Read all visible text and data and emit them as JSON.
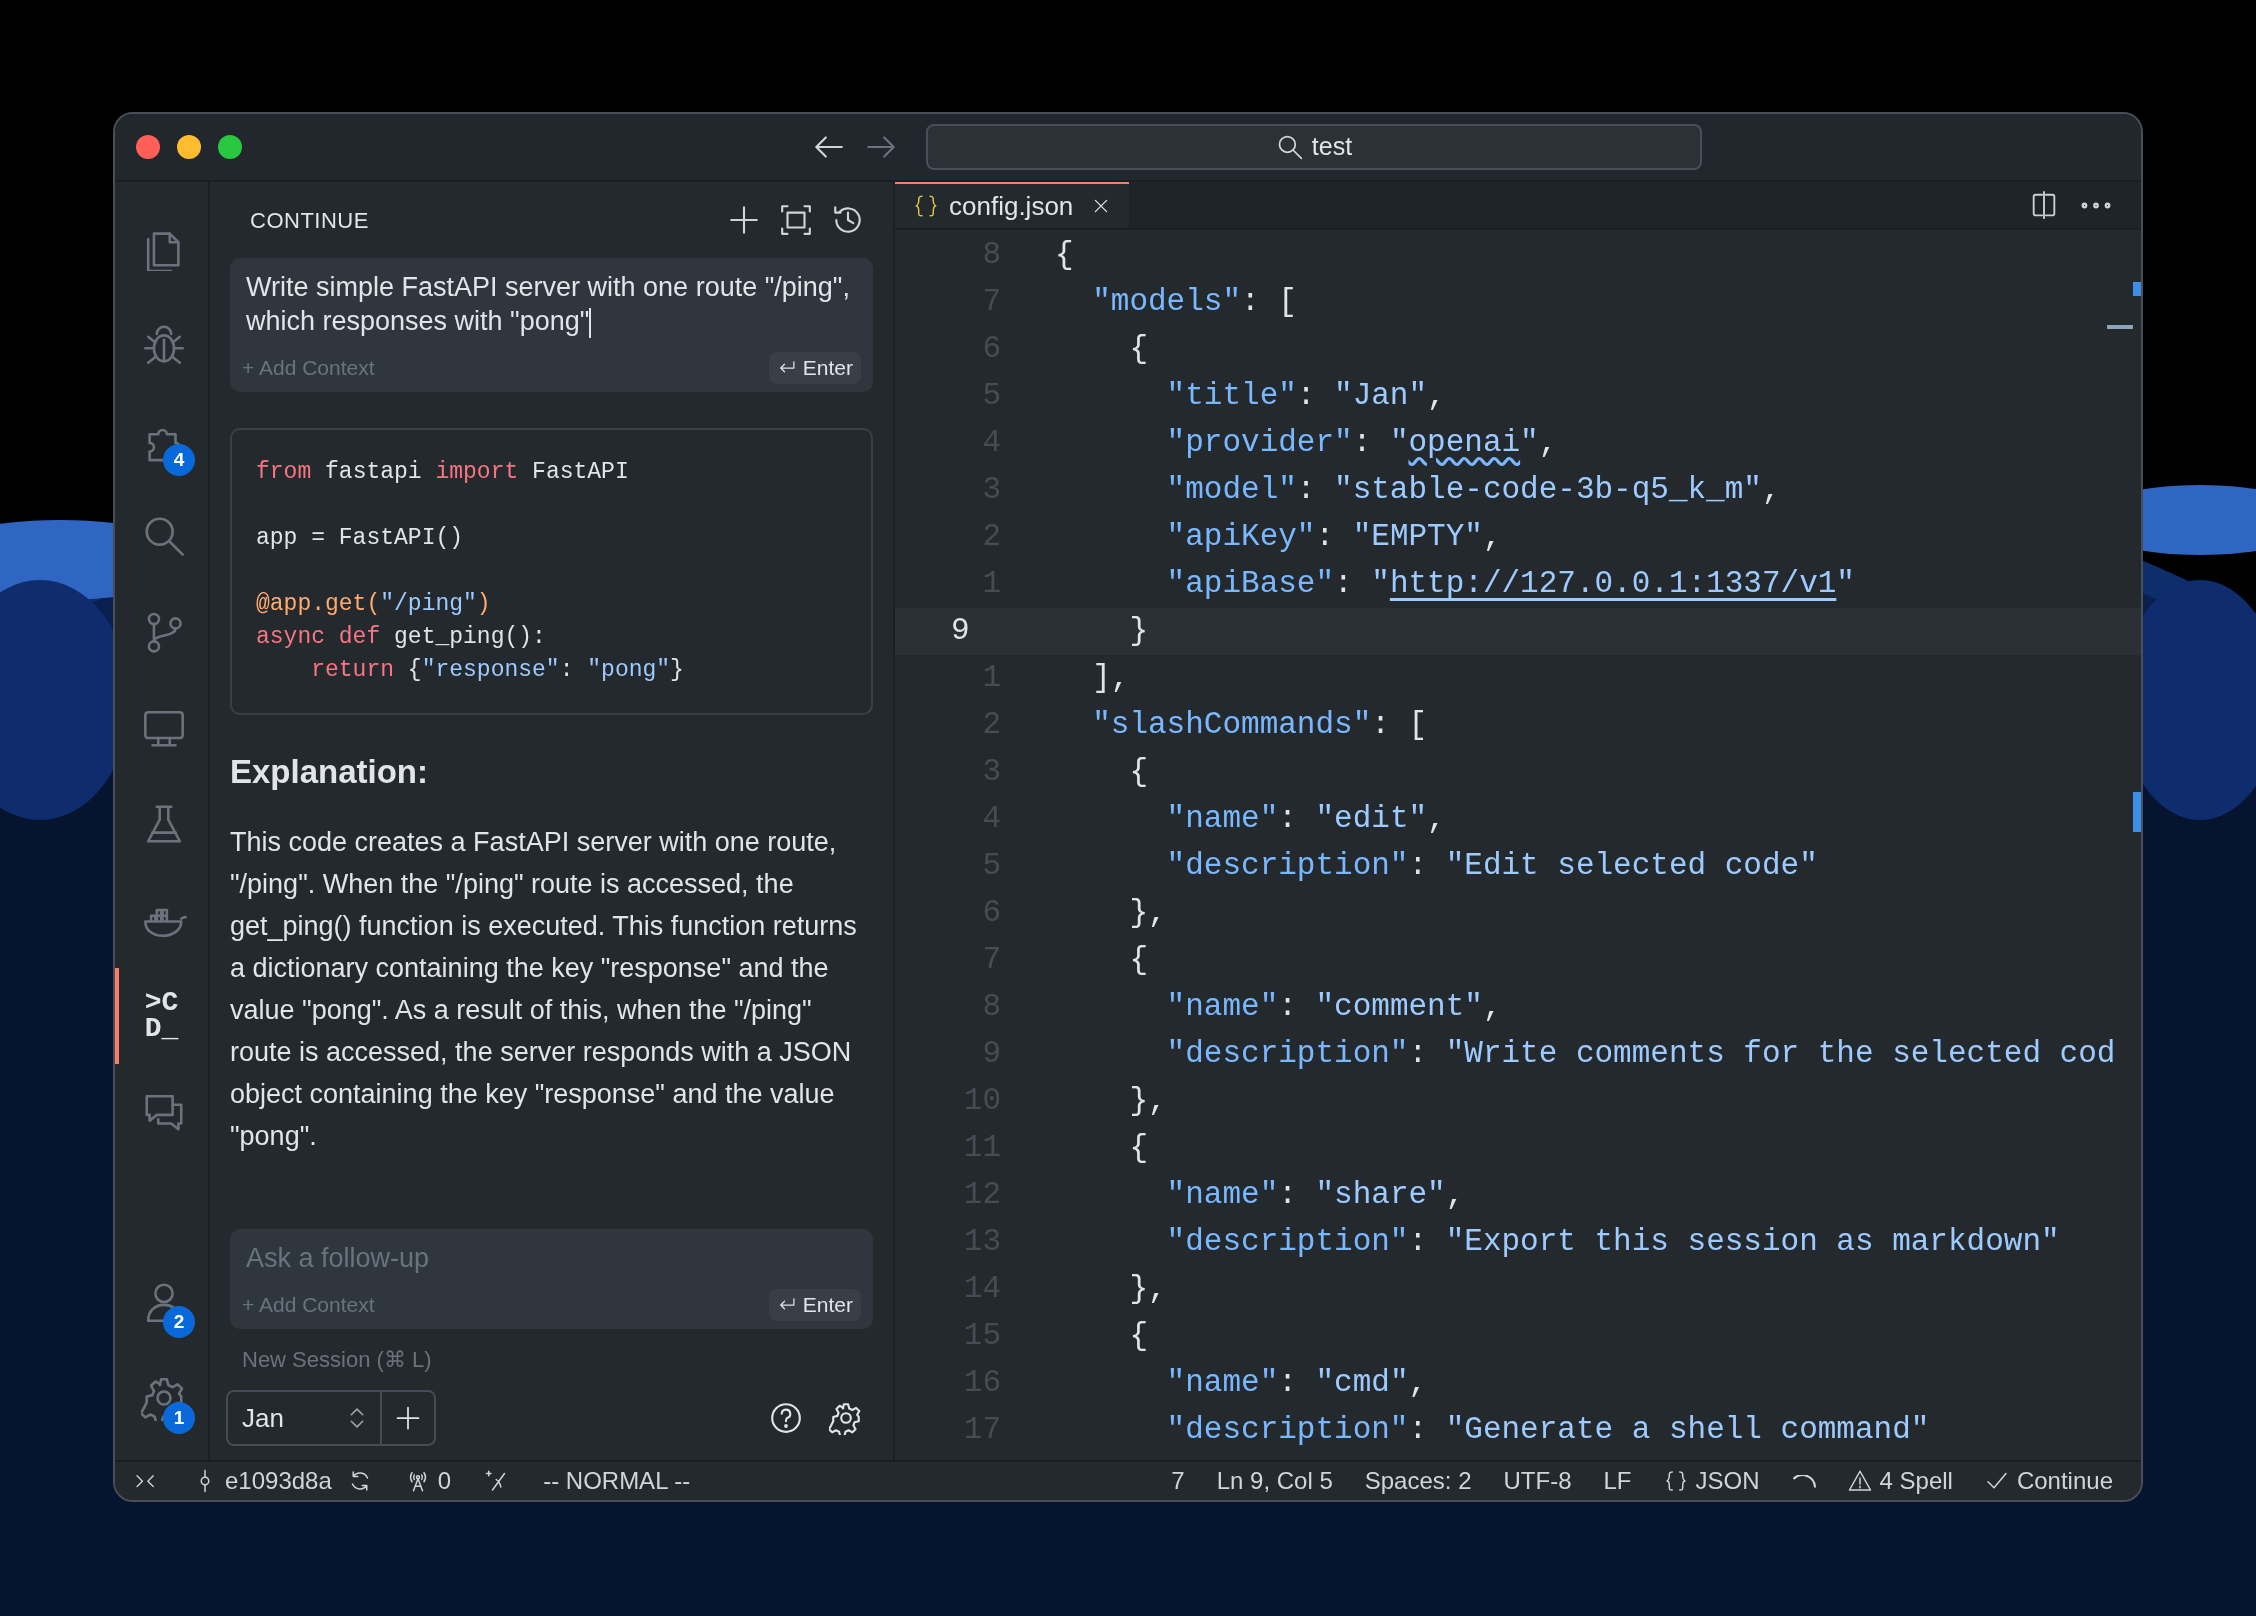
{
  "window": {
    "nav": [
      {
        "kind": "back",
        "disabled": false
      },
      {
        "kind": "forward",
        "disabled": true
      }
    ],
    "search": {
      "value": "test"
    }
  },
  "activity_bar": {
    "top": [
      {
        "kind": "files",
        "selected": false
      },
      {
        "kind": "debug",
        "selected": false
      },
      {
        "kind": "extensions",
        "selected": false,
        "badge": "4"
      },
      {
        "kind": "search",
        "selected": false
      },
      {
        "kind": "source-control",
        "selected": false
      },
      {
        "kind": "remote",
        "selected": false
      },
      {
        "kind": "testing",
        "selected": false
      },
      {
        "kind": "docker",
        "selected": false
      },
      {
        "kind": "continue",
        "selected": true,
        "lines": [
          ">C",
          "D_"
        ]
      },
      {
        "kind": "chat",
        "selected": false
      }
    ],
    "bottom": [
      {
        "kind": "accounts",
        "selected": false,
        "badge": "2"
      },
      {
        "kind": "settings",
        "selected": false,
        "badge": "1"
      }
    ]
  },
  "side_panel": {
    "title": "CONTINUE",
    "actions": [
      {
        "kind": "add"
      },
      {
        "kind": "fullscreen"
      },
      {
        "kind": "history"
      }
    ],
    "prompt": {
      "text": "Write simple FastAPI server with one route \"/ping\", which responses with \"pong\"",
      "add_context": "+ Add Context",
      "enter": "Enter"
    },
    "code_block": [
      {
        "lines": [
          [
            {
              "kind": "kw",
              "text": "from"
            },
            {
              "kind": "plain",
              "text": " fastapi "
            },
            {
              "kind": "kw",
              "text": "import"
            },
            {
              "kind": "plain",
              "text": " FastAPI"
            }
          ]
        ]
      },
      {
        "lines": [
          [
            {
              "kind": "plain",
              "text": "app = FastAPI()"
            }
          ]
        ]
      },
      {
        "lines": [
          [
            {
              "kind": "dec",
              "text": "@app.get("
            },
            {
              "kind": "str",
              "text": "\"/ping\""
            },
            {
              "kind": "dec",
              "text": ")"
            }
          ],
          [
            {
              "kind": "kw",
              "text": "async def"
            },
            {
              "kind": "plain",
              "text": " get_ping():"
            }
          ],
          [
            {
              "kind": "kw",
              "text": "    return"
            },
            {
              "kind": "plain",
              "text": " {"
            },
            {
              "kind": "str",
              "text": "\"response\""
            },
            {
              "kind": "plain",
              "text": ": "
            },
            {
              "kind": "str",
              "text": "\"pong\""
            },
            {
              "kind": "plain",
              "text": "}"
            }
          ]
        ]
      }
    ],
    "heading": "Explanation:",
    "paragraph": "This code creates a FastAPI server with one route, \"/ping\". When the \"/ping\" route is accessed, the get_ping() function is executed. This function returns a dictionary containing the key \"response\" and the value \"pong\". As a result of this, when the \"/ping\" route is accessed, the server responds with a JSON object containing the key \"response\" and the value \"pong\".",
    "follow_up": {
      "placeholder": "Ask a follow-up",
      "add_context": "+ Add Context",
      "enter": "Enter"
    },
    "new_session": "New Session (⌘ L)",
    "model": "Jan"
  },
  "editor": {
    "tabs": [
      {
        "label": "config.json",
        "selected": true
      }
    ],
    "lines": [
      {
        "number": "8",
        "current": false,
        "tokens": [
          {
            "kind": "p",
            "text": "{"
          }
        ]
      },
      {
        "number": "7",
        "current": false,
        "tokens": [
          {
            "kind": "k",
            "text": "  \"models\""
          },
          {
            "kind": "p",
            "text": ": ["
          }
        ]
      },
      {
        "number": "6",
        "current": false,
        "tokens": [
          {
            "kind": "p",
            "text": "    {"
          }
        ]
      },
      {
        "number": "5",
        "current": false,
        "tokens": [
          {
            "kind": "k",
            "text": "      \"title\""
          },
          {
            "kind": "p",
            "text": ": "
          },
          {
            "kind": "s",
            "text": "\"Jan\""
          },
          {
            "kind": "p",
            "text": ","
          }
        ]
      },
      {
        "number": "4",
        "current": false,
        "tokens": [
          {
            "kind": "k",
            "text": "      \"provider\""
          },
          {
            "kind": "p",
            "text": ": "
          },
          {
            "kind": "s",
            "text": "\""
          },
          {
            "kind": "spell",
            "text": "openai"
          },
          {
            "kind": "s",
            "text": "\""
          },
          {
            "kind": "p",
            "text": ","
          }
        ]
      },
      {
        "number": "3",
        "current": false,
        "tokens": [
          {
            "kind": "k",
            "text": "      \"model\""
          },
          {
            "kind": "p",
            "text": ": "
          },
          {
            "kind": "s",
            "text": "\"stable-code-3b-q5_k_m\""
          },
          {
            "kind": "p",
            "text": ","
          }
        ]
      },
      {
        "number": "2",
        "current": false,
        "tokens": [
          {
            "kind": "k",
            "text": "      \"apiKey\""
          },
          {
            "kind": "p",
            "text": ": "
          },
          {
            "kind": "s",
            "text": "\"EMPTY\""
          },
          {
            "kind": "p",
            "text": ","
          }
        ]
      },
      {
        "number": "1",
        "current": false,
        "tokens": [
          {
            "kind": "k",
            "text": "      \"apiBase\""
          },
          {
            "kind": "p",
            "text": ": "
          },
          {
            "kind": "s",
            "text": "\""
          },
          {
            "kind": "link",
            "text": "http://127.0.0.1:1337/v1"
          },
          {
            "kind": "s",
            "text": "\""
          }
        ]
      },
      {
        "number": "9",
        "current": true,
        "tokens": [
          {
            "kind": "p",
            "text": "    }"
          }
        ]
      },
      {
        "number": "1",
        "current": false,
        "tokens": [
          {
            "kind": "p",
            "text": "  ],"
          }
        ]
      },
      {
        "number": "2",
        "current": false,
        "tokens": [
          {
            "kind": "k",
            "text": "  \"slashCommands\""
          },
          {
            "kind": "p",
            "text": ": ["
          }
        ]
      },
      {
        "number": "3",
        "current": false,
        "tokens": [
          {
            "kind": "p",
            "text": "    {"
          }
        ]
      },
      {
        "number": "4",
        "current": false,
        "tokens": [
          {
            "kind": "k",
            "text": "      \"name\""
          },
          {
            "kind": "p",
            "text": ": "
          },
          {
            "kind": "s",
            "text": "\"edit\""
          },
          {
            "kind": "p",
            "text": ","
          }
        ]
      },
      {
        "number": "5",
        "current": false,
        "tokens": [
          {
            "kind": "k",
            "text": "      \"description\""
          },
          {
            "kind": "p",
            "text": ": "
          },
          {
            "kind": "s",
            "text": "\"Edit selected code\""
          }
        ]
      },
      {
        "number": "6",
        "current": false,
        "tokens": [
          {
            "kind": "p",
            "text": "    },"
          }
        ]
      },
      {
        "number": "7",
        "current": false,
        "tokens": [
          {
            "kind": "p",
            "text": "    {"
          }
        ]
      },
      {
        "number": "8",
        "current": false,
        "tokens": [
          {
            "kind": "k",
            "text": "      \"name\""
          },
          {
            "kind": "p",
            "text": ": "
          },
          {
            "kind": "s",
            "text": "\"comment\""
          },
          {
            "kind": "p",
            "text": ","
          }
        ]
      },
      {
        "number": "9",
        "current": false,
        "tokens": [
          {
            "kind": "k",
            "text": "      \"description\""
          },
          {
            "kind": "p",
            "text": ": "
          },
          {
            "kind": "s",
            "text": "\"Write comments for the selected cod"
          }
        ]
      },
      {
        "number": "10",
        "current": false,
        "tokens": [
          {
            "kind": "p",
            "text": "    },"
          }
        ]
      },
      {
        "number": "11",
        "current": false,
        "tokens": [
          {
            "kind": "p",
            "text": "    {"
          }
        ]
      },
      {
        "number": "12",
        "current": false,
        "tokens": [
          {
            "kind": "k",
            "text": "      \"name\""
          },
          {
            "kind": "p",
            "text": ": "
          },
          {
            "kind": "s",
            "text": "\"share\""
          },
          {
            "kind": "p",
            "text": ","
          }
        ]
      },
      {
        "number": "13",
        "current": false,
        "tokens": [
          {
            "kind": "k",
            "text": "      \"description\""
          },
          {
            "kind": "p",
            "text": ": "
          },
          {
            "kind": "s",
            "text": "\"Export this session as markdown\""
          }
        ]
      },
      {
        "number": "14",
        "current": false,
        "tokens": [
          {
            "kind": "p",
            "text": "    },"
          }
        ]
      },
      {
        "number": "15",
        "current": false,
        "tokens": [
          {
            "kind": "p",
            "text": "    {"
          }
        ]
      },
      {
        "number": "16",
        "current": false,
        "tokens": [
          {
            "kind": "k",
            "text": "      \"name\""
          },
          {
            "kind": "p",
            "text": ": "
          },
          {
            "kind": "s",
            "text": "\"cmd\""
          },
          {
            "kind": "p",
            "text": ","
          }
        ]
      },
      {
        "number": "17",
        "current": false,
        "tokens": [
          {
            "kind": "k",
            "text": "      \"description\""
          },
          {
            "kind": "p",
            "text": ": "
          },
          {
            "kind": "s",
            "text": "\"Generate a shell command\""
          }
        ]
      }
    ]
  },
  "status_bar": {
    "left": [
      {
        "kind": "remote"
      },
      {
        "kind": "branch",
        "text": "e1093d8a"
      },
      {
        "kind": "sync"
      },
      {
        "kind": "ports",
        "text": "0"
      },
      {
        "kind": "sparkle"
      },
      {
        "kind": "plain",
        "text": "-- NORMAL --"
      }
    ],
    "right": [
      {
        "kind": "plain",
        "text": "7"
      },
      {
        "kind": "plain",
        "text": "Ln 9, Col 5"
      },
      {
        "kind": "plain",
        "text": "Spaces: 2"
      },
      {
        "kind": "plain",
        "text": "UTF-8"
      },
      {
        "kind": "plain",
        "text": "LF"
      },
      {
        "kind": "language",
        "text": "JSON"
      },
      {
        "kind": "spinner"
      },
      {
        "kind": "warning",
        "text": "4 Spell"
      },
      {
        "kind": "check",
        "text": "Continue"
      }
    ]
  }
}
